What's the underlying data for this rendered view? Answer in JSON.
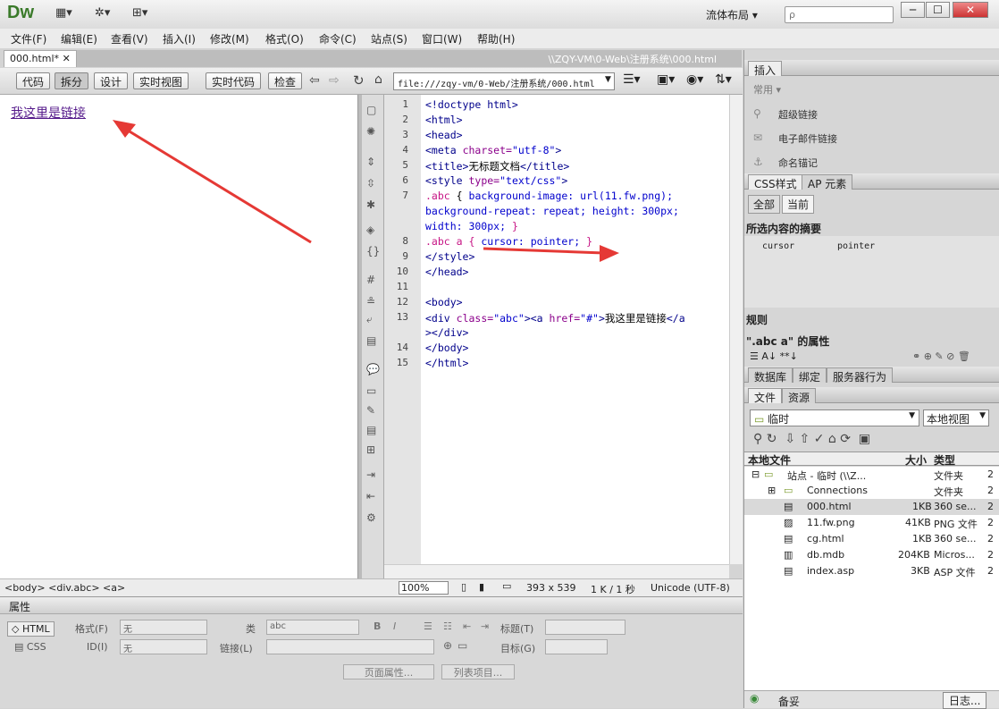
{
  "app": {
    "logo": "Dw",
    "layout": "流体布局",
    "search_placeholder": "ρ"
  },
  "window": {
    "minimize": "─",
    "maximize": "☐",
    "close": "✕"
  },
  "menu": [
    "文件(F)",
    "编辑(E)",
    "查看(V)",
    "插入(I)",
    "修改(M)",
    "格式(O)",
    "命令(C)",
    "站点(S)",
    "窗口(W)",
    "帮助(H)"
  ],
  "doc": {
    "tab": "000.html*",
    "path": "\\\\ZQY-VM\\0-Web\\注册系统\\000.html"
  },
  "toolbar": {
    "buttons": [
      "代码",
      "拆分",
      "设计",
      "实时视图"
    ],
    "live_code": "实时代码",
    "inspect": "检查",
    "url": "file:///zqy-vm/0-Web/注册系统/000.html"
  },
  "design": {
    "link_text": "我这里是链接"
  },
  "code": {
    "line_numbers": [
      "1",
      "2",
      "3",
      "4",
      "5",
      "6",
      "7",
      "",
      "",
      "8",
      "9",
      "10",
      "11",
      "12",
      "13",
      "",
      "14",
      "15"
    ]
  },
  "status": {
    "tags": "<body> <div.abc> <a>",
    "zoom": "100%",
    "size": "393 x 539",
    "file": "1 K / 1 秒",
    "encoding": "Unicode (UTF-8)"
  },
  "properties": {
    "title": "属性",
    "html": "HTML",
    "css": "CSS",
    "format_label": "格式(F)",
    "format_value": "无",
    "class_label": "类",
    "class_value": "abc",
    "id_label": "ID(I)",
    "id_value": "无",
    "link_label": "链接(L)",
    "title_label": "标题(T)",
    "target_label": "目标(G)",
    "page_props": "页面属性...",
    "list_item": "列表项目..."
  },
  "insert": {
    "tab": "插入",
    "category": "常用",
    "items": [
      "超级链接",
      "电子邮件链接",
      "命名锚记"
    ]
  },
  "css": {
    "tabs": [
      "CSS样式",
      "AP 元素"
    ],
    "modes": [
      "全部",
      "当前"
    ],
    "summary_title": "所选内容的摘要",
    "prop_name": "cursor",
    "prop_value": "pointer",
    "rules_title": "规则",
    "props_title": "\".abc a\" 的属性"
  },
  "db_tabs": [
    "数据库",
    "绑定",
    "服务器行为"
  ],
  "files": {
    "tabs": [
      "文件",
      "资源"
    ],
    "site": "临时",
    "view": "本地视图",
    "headers": [
      "本地文件",
      "大小",
      "类型"
    ],
    "rows": [
      {
        "name": "站点 - 临时 (\\\\Z...",
        "size": "",
        "type": "文件夹",
        "extra": "2"
      },
      {
        "name": "Connections",
        "size": "",
        "type": "文件夹",
        "extra": "2"
      },
      {
        "name": "000.html",
        "size": "1KB",
        "type": "360 se...",
        "extra": "2"
      },
      {
        "name": "11.fw.png",
        "size": "41KB",
        "type": "PNG 文件",
        "extra": "2"
      },
      {
        "name": "cg.html",
        "size": "1KB",
        "type": "360 se...",
        "extra": "2"
      },
      {
        "name": "db.mdb",
        "size": "204KB",
        "type": "Micros...",
        "extra": "2"
      },
      {
        "name": "index.asp",
        "size": "3KB",
        "type": "ASP 文件",
        "extra": "2"
      }
    ],
    "status": "备妥",
    "log": "日志..."
  }
}
